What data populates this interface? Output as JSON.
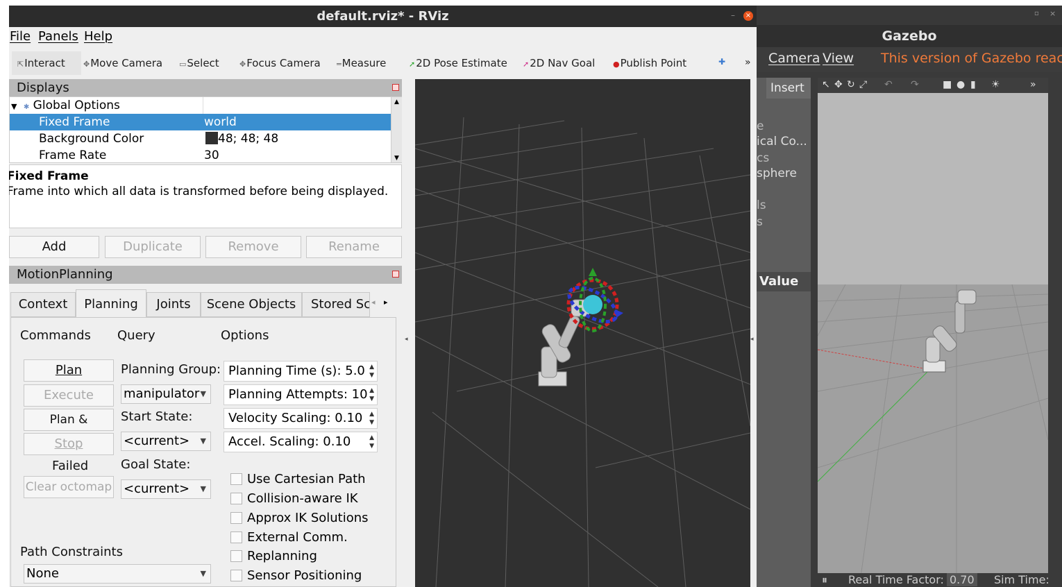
{
  "rviz": {
    "title": "default.rviz* - RViz",
    "menu": [
      "File",
      "Panels",
      "Help"
    ],
    "toolbar": [
      {
        "label": "Interact",
        "icon": "cursor-icon"
      },
      {
        "label": "Move Camera",
        "icon": "move-camera-icon"
      },
      {
        "label": "Select",
        "icon": "select-box-icon"
      },
      {
        "label": "Focus Camera",
        "icon": "focus-camera-icon"
      },
      {
        "label": "Measure",
        "icon": "ruler-icon"
      },
      {
        "label": "2D Pose Estimate",
        "icon": "pose-arrow-green-icon"
      },
      {
        "label": "2D Nav Goal",
        "icon": "nav-arrow-pink-icon"
      },
      {
        "label": "Publish Point",
        "icon": "map-pin-icon"
      }
    ],
    "displays": {
      "header": "Displays",
      "global_options": "Global Options",
      "rows": [
        {
          "name": "Fixed Frame",
          "value": "world"
        },
        {
          "name": "Background Color",
          "value": "48; 48; 48",
          "swatch": "#303030"
        },
        {
          "name": "Frame Rate",
          "value": "30"
        }
      ],
      "desc_title": "Fixed Frame",
      "desc_text": "Frame into which all data is transformed before being displayed.",
      "buttons": [
        "Add",
        "Duplicate",
        "Remove",
        "Rename"
      ]
    },
    "motion": {
      "header": "MotionPlanning",
      "tabs": [
        "Context",
        "Planning",
        "Joints",
        "Scene Objects",
        "Stored Sc"
      ],
      "commands_label": "Commands",
      "query_label": "Query",
      "options_label": "Options",
      "commands": [
        "Plan",
        "Execute",
        "Plan & Execute",
        "Stop"
      ],
      "status": "Failed",
      "clear_octomap": "Clear octomap",
      "planning_group_label": "Planning Group:",
      "planning_group": "manipulator",
      "start_state_label": "Start State:",
      "start_state": "<current>",
      "goal_state_label": "Goal State:",
      "goal_state": "<current>",
      "planning_time": "Planning Time (s): 5.0",
      "planning_attempts": "Planning Attempts: 10",
      "velocity_scaling": "Velocity Scaling: 0.10",
      "accel_scaling": "Accel. Scaling: 0.10",
      "checks": [
        "Use Cartesian Path",
        "Collision-aware IK",
        "Approx IK Solutions",
        "External Comm.",
        "Replanning",
        "Sensor Positioning"
      ],
      "path_constraints_label": "Path Constraints",
      "path_constraints": "None"
    },
    "viewport_bg": "#303030"
  },
  "gazebo": {
    "title": "Gazebo",
    "menu": [
      "Camera",
      "View"
    ],
    "notice": "This version of Gazebo reaches",
    "insert_tab": "Insert",
    "left_items": [
      "e",
      "ical Co...",
      "cs",
      "sphere",
      "ls",
      "s"
    ],
    "value_header": "Value",
    "realtime_label": "Real Time Factor:",
    "realtime_value": "0.70",
    "simtime_label": "Sim Time:",
    "notice_color": "#f07a3a"
  }
}
